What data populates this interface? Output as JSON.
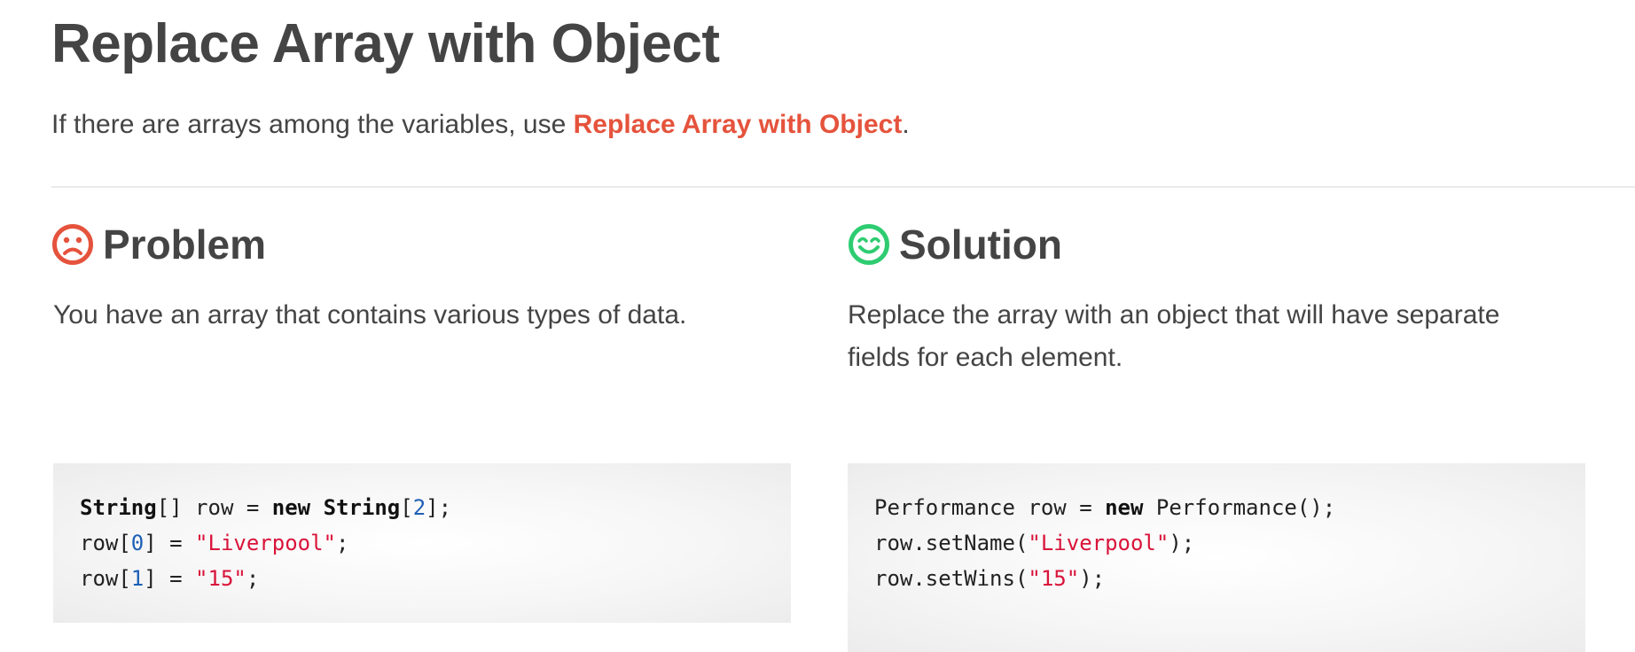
{
  "page": {
    "title": "Replace Array with Object",
    "intro": {
      "prefix": "If there are arrays among the variables, use ",
      "link": "Replace Array with Object",
      "suffix": "."
    }
  },
  "problem": {
    "icon": "sad-face-icon",
    "icon_color": "#e5533c",
    "heading": "Problem",
    "text": "You have an array that contains various types of data.",
    "code": {
      "l1_t1": "String",
      "l1_t2": "[] row = ",
      "l1_t3": "new",
      "l1_t4": " ",
      "l1_t5": "String",
      "l1_t6": "[",
      "l1_t7": "2",
      "l1_t8": "];",
      "l2_t1": "row[",
      "l2_t2": "0",
      "l2_t3": "] = ",
      "l2_t4": "\"Liverpool\"",
      "l2_t5": ";",
      "l3_t1": "row[",
      "l3_t2": "1",
      "l3_t3": "] = ",
      "l3_t4": "\"15\"",
      "l3_t5": ";"
    }
  },
  "solution": {
    "icon": "happy-face-icon",
    "icon_color": "#2ecc71",
    "heading": "Solution",
    "text": "Replace the array with an object that will have separate fields for each element.",
    "code": {
      "l1_t1": "Performance row = ",
      "l1_t2": "new",
      "l1_t3": " Performance();",
      "l2_t1": "row.setName(",
      "l2_t2": "\"Liverpool\"",
      "l2_t3": ");",
      "l3_t1": "row.setWins(",
      "l3_t2": "\"15\"",
      "l3_t3": ");"
    }
  },
  "colors": {
    "text": "#444444",
    "link": "#e5533c",
    "code_number": "#1c5fb6",
    "code_string": "#d9143a"
  }
}
